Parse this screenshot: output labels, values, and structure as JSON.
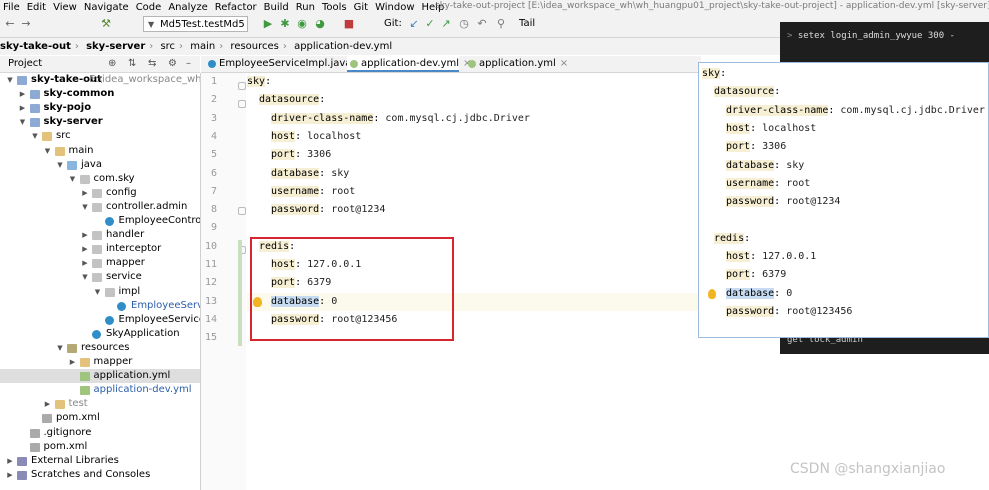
{
  "window_title": "sky-take-out-project [E:\\idea_workspace_wh\\wh_huangpu01_project\\sky-take-out-project] - application-dev.yml [sky-server]",
  "menu": [
    "File",
    "Edit",
    "View",
    "Navigate",
    "Code",
    "Analyze",
    "Refactor",
    "Build",
    "Run",
    "Tools",
    "Git",
    "Window",
    "Help"
  ],
  "toolbar": {
    "run_config": "Md5Test.testMd5",
    "git_label": "Git:",
    "tail_label": "Tail"
  },
  "breadcrumb": [
    "sky-take-out",
    "sky-server",
    "src",
    "main",
    "resources",
    "application-dev.yml"
  ],
  "project_panel": {
    "title": "Project"
  },
  "tree": [
    {
      "label": "sky-take-out",
      "suffix": "E:\\idea_workspace_wh\\wh",
      "depth": 0,
      "arrow": "down",
      "icon": "module",
      "style": "bold"
    },
    {
      "label": "sky-common",
      "depth": 1,
      "arrow": "right",
      "icon": "module",
      "style": "bold"
    },
    {
      "label": "sky-pojo",
      "depth": 1,
      "arrow": "right",
      "icon": "module",
      "style": "bold"
    },
    {
      "label": "sky-server",
      "depth": 1,
      "arrow": "down",
      "icon": "module",
      "style": "bold"
    },
    {
      "label": "src",
      "depth": 2,
      "arrow": "down",
      "icon": "folder"
    },
    {
      "label": "main",
      "depth": 3,
      "arrow": "down",
      "icon": "folder"
    },
    {
      "label": "java",
      "depth": 4,
      "arrow": "down",
      "icon": "srcfolder"
    },
    {
      "label": "com.sky",
      "depth": 5,
      "arrow": "down",
      "icon": "pkg"
    },
    {
      "label": "config",
      "depth": 6,
      "arrow": "right",
      "icon": "pkg"
    },
    {
      "label": "controller.admin",
      "depth": 6,
      "arrow": "down",
      "icon": "pkg"
    },
    {
      "label": "EmployeeContro",
      "depth": 7,
      "arrow": "",
      "icon": "cls"
    },
    {
      "label": "handler",
      "depth": 6,
      "arrow": "right",
      "icon": "pkg"
    },
    {
      "label": "interceptor",
      "depth": 6,
      "arrow": "right",
      "icon": "pkg"
    },
    {
      "label": "mapper",
      "depth": 6,
      "arrow": "right",
      "icon": "pkg"
    },
    {
      "label": "service",
      "depth": 6,
      "arrow": "down",
      "icon": "pkg"
    },
    {
      "label": "impl",
      "depth": 7,
      "arrow": "down",
      "icon": "pkg"
    },
    {
      "label": "EmployeeServ",
      "depth": 8,
      "arrow": "",
      "icon": "cls",
      "style": "blue"
    },
    {
      "label": "EmployeeService",
      "depth": 7,
      "arrow": "",
      "icon": "cls"
    },
    {
      "label": "SkyApplication",
      "depth": 6,
      "arrow": "",
      "icon": "cls"
    },
    {
      "label": "resources",
      "depth": 4,
      "arrow": "down",
      "icon": "resfolder"
    },
    {
      "label": "mapper",
      "depth": 5,
      "arrow": "right",
      "icon": "folder"
    },
    {
      "label": "application.yml",
      "depth": 5,
      "arrow": "",
      "icon": "yml",
      "selected": true
    },
    {
      "label": "application-dev.yml",
      "depth": 5,
      "arrow": "",
      "icon": "yml",
      "style": "blue"
    },
    {
      "label": "test",
      "depth": 3,
      "arrow": "right",
      "icon": "folder",
      "style": "grey"
    },
    {
      "label": "pom.xml",
      "depth": 2,
      "arrow": "",
      "icon": "file"
    },
    {
      "label": ".gitignore",
      "depth": 1,
      "arrow": "",
      "icon": "file"
    },
    {
      "label": "pom.xml",
      "depth": 1,
      "arrow": "",
      "icon": "file"
    },
    {
      "label": "External Libraries",
      "depth": 0,
      "arrow": "right",
      "icon": "lib"
    },
    {
      "label": "Scratches and Consoles",
      "depth": 0,
      "arrow": "right",
      "icon": "lib"
    }
  ],
  "tabs": [
    {
      "label": "EmployeeServiceImpl.java",
      "icon_color": "#2f8ec7",
      "active": false
    },
    {
      "label": "application-dev.yml",
      "icon_color": "#9fc47d",
      "active": true
    },
    {
      "label": "application.yml",
      "icon_color": "#9fc47d",
      "active": false
    }
  ],
  "editor": {
    "lines": [
      {
        "n": "1",
        "indent": 0,
        "key": "sky",
        "sep": ":",
        "val": ""
      },
      {
        "n": "2",
        "indent": 1,
        "key": "datasource",
        "sep": ":",
        "val": ""
      },
      {
        "n": "3",
        "indent": 2,
        "key": "driver-class-name",
        "sep": ": ",
        "val": "com.mysql.cj.jdbc.Driver"
      },
      {
        "n": "4",
        "indent": 2,
        "key": "host",
        "sep": ": ",
        "val": "localhost"
      },
      {
        "n": "5",
        "indent": 2,
        "key": "port",
        "sep": ": ",
        "val": "3306"
      },
      {
        "n": "6",
        "indent": 2,
        "key": "database",
        "sep": ": ",
        "val": "sky"
      },
      {
        "n": "7",
        "indent": 2,
        "key": "username",
        "sep": ": ",
        "val": "root"
      },
      {
        "n": "8",
        "indent": 2,
        "key": "password",
        "sep": ": ",
        "val": "root@1234"
      },
      {
        "n": "9",
        "indent": 0,
        "key": "",
        "sep": "",
        "val": ""
      },
      {
        "n": "10",
        "indent": 1,
        "key": "redis",
        "sep": ":",
        "val": ""
      },
      {
        "n": "11",
        "indent": 2,
        "key": "host",
        "sep": ": ",
        "val": "127.0.0.1"
      },
      {
        "n": "12",
        "indent": 2,
        "key": "port",
        "sep": ": ",
        "val": "6379"
      },
      {
        "n": "13",
        "indent": 2,
        "key": "database",
        "sep": ": ",
        "val": "0",
        "highlight": true
      },
      {
        "n": "14",
        "indent": 2,
        "key": "password",
        "sep": ": ",
        "val": "root@123456"
      },
      {
        "n": "15",
        "indent": 0,
        "key": "",
        "sep": "",
        "val": ""
      }
    ]
  },
  "popup": {
    "lines": [
      {
        "indent": 0,
        "key": "sky",
        "sep": ":",
        "val": ""
      },
      {
        "indent": 1,
        "key": "datasource",
        "sep": ":",
        "val": ""
      },
      {
        "indent": 2,
        "key": "driver-class-name",
        "sep": ": ",
        "val": "com.mysql.cj.jdbc.Driver"
      },
      {
        "indent": 2,
        "key": "host",
        "sep": ": ",
        "val": "localhost"
      },
      {
        "indent": 2,
        "key": "port",
        "sep": ": ",
        "val": "3306"
      },
      {
        "indent": 2,
        "key": "database",
        "sep": ": ",
        "val": "sky"
      },
      {
        "indent": 2,
        "key": "username",
        "sep": ": ",
        "val": "root"
      },
      {
        "indent": 2,
        "key": "password",
        "sep": ": ",
        "val": "root@1234"
      },
      {
        "indent": 0,
        "key": "",
        "sep": "",
        "val": ""
      },
      {
        "indent": 1,
        "key": "redis",
        "sep": ":",
        "val": ""
      },
      {
        "indent": 2,
        "key": "host",
        "sep": ": ",
        "val": "127.0.0.1"
      },
      {
        "indent": 2,
        "key": "port",
        "sep": ": ",
        "val": "6379"
      },
      {
        "indent": 2,
        "key": "database",
        "sep": ": ",
        "val": "0",
        "highlight": true
      },
      {
        "indent": 2,
        "key": "password",
        "sep": ": ",
        "val": "root@123456"
      }
    ]
  },
  "terminal": {
    "top_line": "setex login_admin_ywyue 300 -",
    "bottom_line": "get lock_admin"
  },
  "watermark": "CSDN @shangxianjiao",
  "colors": {
    "highlight_box": "#d6252d",
    "selection_blue": "#c7dcf2",
    "key_bg": "#f6efd3"
  }
}
